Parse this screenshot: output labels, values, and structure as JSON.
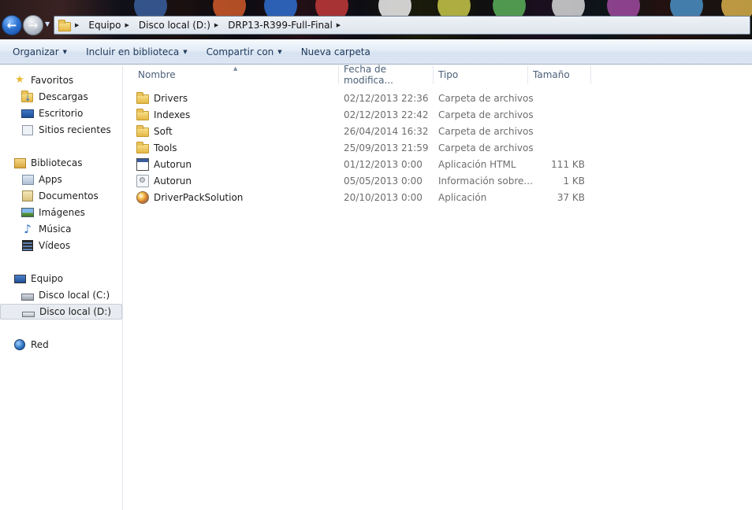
{
  "address": {
    "crumbs": [
      "Equipo",
      "Disco local (D:)",
      "DRP13-R399-Full-Final"
    ]
  },
  "toolbar": {
    "organize": "Organizar",
    "include_library": "Incluir en biblioteca",
    "share": "Compartir con",
    "new_folder": "Nueva carpeta"
  },
  "nav": {
    "favorites": {
      "label": "Favoritos",
      "items": [
        "Descargas",
        "Escritorio",
        "Sitios recientes"
      ]
    },
    "libraries": {
      "label": "Bibliotecas",
      "items": [
        "Apps",
        "Documentos",
        "Imágenes",
        "Música",
        "Vídeos"
      ]
    },
    "computer": {
      "label": "Equipo",
      "items": [
        "Disco local (C:)",
        "Disco local (D:)"
      ],
      "selected": "Disco local (D:)"
    },
    "network": {
      "label": "Red"
    }
  },
  "columns": {
    "name": "Nombre",
    "date": "Fecha de modifica...",
    "type": "Tipo",
    "size": "Tamaño"
  },
  "files": [
    {
      "name": "Drivers",
      "date": "02/12/2013 22:36",
      "type": "Carpeta de archivos",
      "size": "",
      "icon": "folder"
    },
    {
      "name": "Indexes",
      "date": "02/12/2013 22:42",
      "type": "Carpeta de archivos",
      "size": "",
      "icon": "folder"
    },
    {
      "name": "Soft",
      "date": "26/04/2014 16:32",
      "type": "Carpeta de archivos",
      "size": "",
      "icon": "folder"
    },
    {
      "name": "Tools",
      "date": "25/09/2013 21:59",
      "type": "Carpeta de archivos",
      "size": "",
      "icon": "folder"
    },
    {
      "name": "Autorun",
      "date": "01/12/2013 0:00",
      "type": "Aplicación HTML",
      "size": "111 KB",
      "icon": "html-file"
    },
    {
      "name": "Autorun",
      "date": "05/05/2013 0:00",
      "type": "Información sobre...",
      "size": "1 KB",
      "icon": "inf-file"
    },
    {
      "name": "DriverPackSolution",
      "date": "20/10/2013 0:00",
      "type": "Aplicación",
      "size": "37 KB",
      "icon": "application"
    }
  ],
  "colors": {
    "accent": "#1e395b",
    "selection": "#e8ebf0",
    "header_text": "#4c607a",
    "meta_text": "#6d6d6d"
  }
}
